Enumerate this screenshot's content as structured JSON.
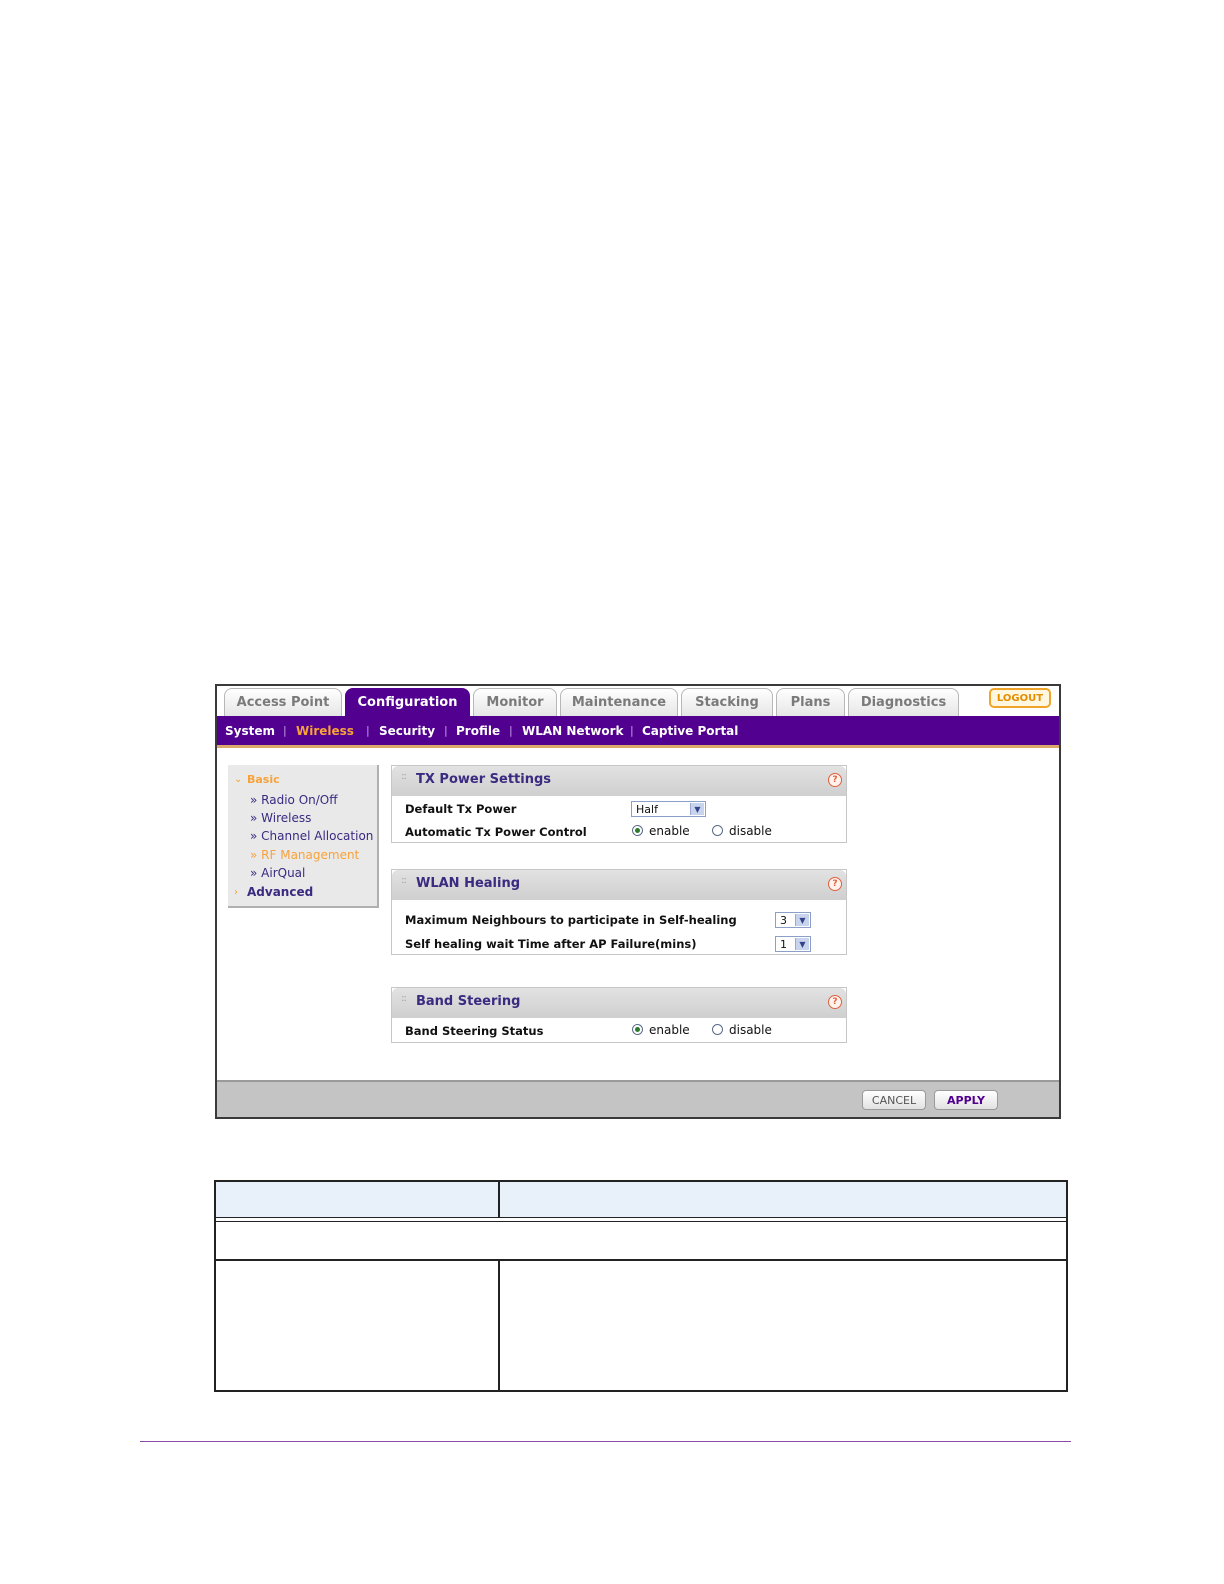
{
  "tabs": [
    {
      "label": "Access Point",
      "active": false
    },
    {
      "label": "Configuration",
      "active": true
    },
    {
      "label": "Monitor",
      "active": false
    },
    {
      "label": "Maintenance",
      "active": false
    },
    {
      "label": "Stacking",
      "active": false
    },
    {
      "label": "Plans",
      "active": false
    },
    {
      "label": "Diagnostics",
      "active": false
    }
  ],
  "logout_label": "LOGOUT",
  "subnav": [
    {
      "label": "System",
      "active": false
    },
    {
      "label": "Wireless",
      "active": true
    },
    {
      "label": "Security",
      "active": false
    },
    {
      "label": "Profile",
      "active": false
    },
    {
      "label": "WLAN Network",
      "active": false
    },
    {
      "label": "Captive Portal",
      "active": false
    }
  ],
  "sidebar": {
    "basic_label": "Basic",
    "items": [
      {
        "label": "» Radio On/Off",
        "active": false
      },
      {
        "label": "» Wireless",
        "active": false
      },
      {
        "label": "» Channel Allocation",
        "active": false
      },
      {
        "label": "» RF Management",
        "active": true
      },
      {
        "label": "» AirQual",
        "active": false
      }
    ],
    "advanced_label": "Advanced"
  },
  "tx_power": {
    "title": "TX Power Settings",
    "default_label": "Default Tx Power",
    "default_value": "Half",
    "auto_label": "Automatic Tx Power Control",
    "enable_label": "enable",
    "disable_label": "disable",
    "auto_selected": "enable"
  },
  "wlan_healing": {
    "title": "WLAN Healing",
    "max_neighbours_label": "Maximum Neighbours to participate in Self-healing",
    "max_neighbours_value": "3",
    "wait_time_label": "Self healing wait Time after AP Failure(mins)",
    "wait_time_value": "1"
  },
  "band_steering": {
    "title": "Band Steering",
    "status_label": "Band Steering Status",
    "enable_label": "enable",
    "disable_label": "disable",
    "status_selected": "enable"
  },
  "help_glyph": "?",
  "footer": {
    "cancel_label": "CANCEL",
    "apply_label": "APPLY"
  },
  "colors": {
    "brand_purple": "#51008f",
    "active_orange": "#f7a23a"
  }
}
